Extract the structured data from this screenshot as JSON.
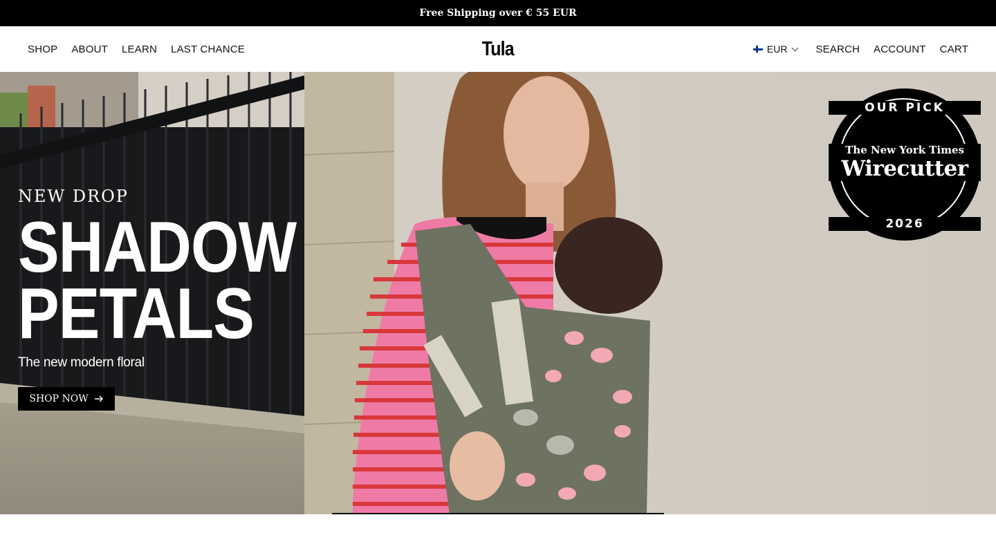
{
  "announcement": {
    "text": "Free Shipping over € 55 EUR"
  },
  "header": {
    "logo": "Tula",
    "nav_left": [
      "SHOP",
      "ABOUT",
      "LEARN",
      "LAST CHANCE"
    ],
    "currency": {
      "code": "EUR",
      "flag_icon": "finland-flag-icon"
    },
    "nav_right": [
      "SEARCH",
      "ACCOUNT",
      "CART"
    ]
  },
  "hero": {
    "eyebrow": "NEW DROP",
    "headline_line1": "SHADOW",
    "headline_line2": "PETALS",
    "subline": "The new modern floral",
    "cta_label": "SHOP NOW",
    "cta_icon": "arrow-right-icon"
  },
  "badge": {
    "top": "OUR PICK",
    "publisher": "The New York Times",
    "brand": "Wirecutter",
    "year": "2026"
  },
  "colors": {
    "announcement_bg": "#000000",
    "text": "#111111",
    "cta_bg": "#000000"
  }
}
